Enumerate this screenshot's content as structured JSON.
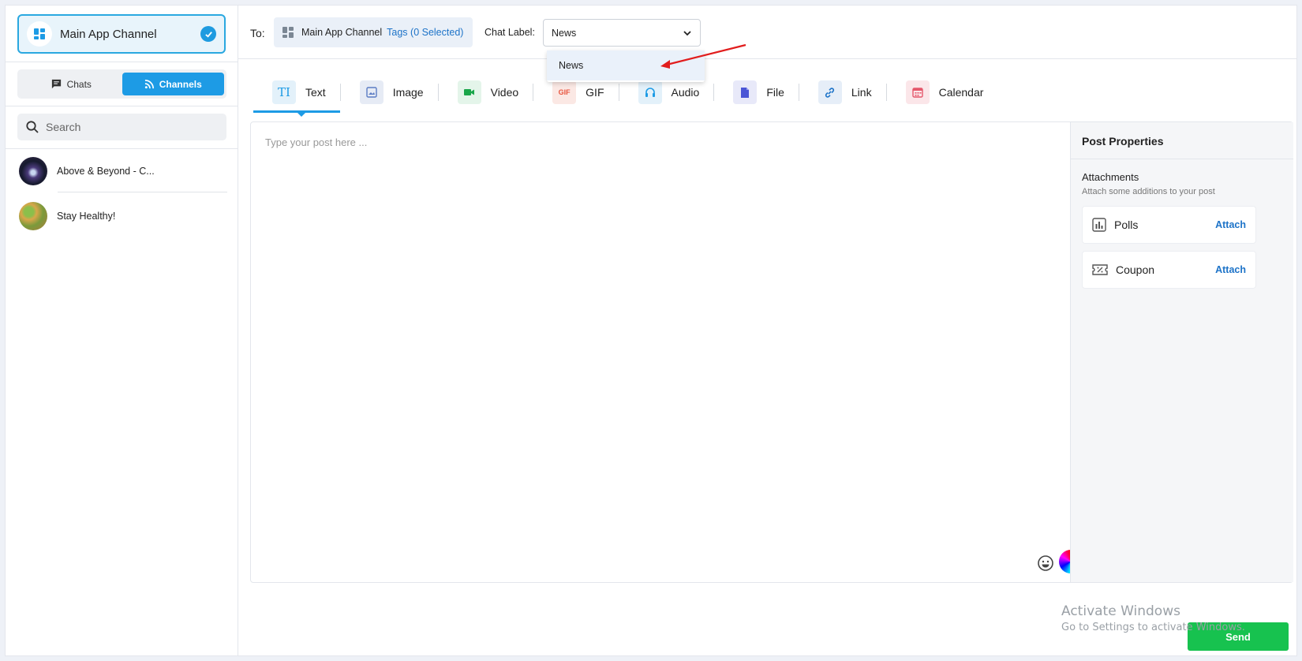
{
  "sidebar": {
    "channel": {
      "name": "Main App Channel"
    },
    "segments": {
      "chats": "Chats",
      "channels": "Channels"
    },
    "search": {
      "placeholder": "Search"
    },
    "conversations": [
      {
        "label": "Above & Beyond - C..."
      },
      {
        "label": "Stay Healthy!"
      }
    ]
  },
  "header": {
    "to_label": "To:",
    "chip_name": "Main App Channel",
    "tags": "Tags (0 Selected)",
    "chat_label": "Chat Label:",
    "selected_label": "News",
    "dropdown_options": [
      "News"
    ]
  },
  "tabs": [
    {
      "label": "Text",
      "icon": "text-icon",
      "color": "#1d9be5"
    },
    {
      "label": "Image",
      "icon": "image-icon",
      "color": "#5b7cc4"
    },
    {
      "label": "Video",
      "icon": "video-icon",
      "color": "#1aa64a"
    },
    {
      "label": "GIF",
      "icon": "gif-icon",
      "color": "#e8553f"
    },
    {
      "label": "Audio",
      "icon": "audio-icon",
      "color": "#1d9be5"
    },
    {
      "label": "File",
      "icon": "file-icon",
      "color": "#4b56d6"
    },
    {
      "label": "Link",
      "icon": "link-icon",
      "color": "#1d73c8"
    },
    {
      "label": "Calendar",
      "icon": "calendar-icon",
      "color": "#e5576b"
    }
  ],
  "editor": {
    "placeholder": "Type your post here ..."
  },
  "properties": {
    "title": "Post Properties",
    "attachments_title": "Attachments",
    "attachments_sub": "Attach some additions to your post",
    "items": [
      {
        "name": "Polls",
        "action": "Attach"
      },
      {
        "name": "Coupon",
        "action": "Attach"
      }
    ]
  },
  "send_label": "Send",
  "watermark": {
    "line1": "Activate Windows",
    "line2": "Go to Settings to activate Windows."
  },
  "colors": {
    "accent": "#1d9be5",
    "send": "#17c24f",
    "link": "#1d73c8"
  }
}
